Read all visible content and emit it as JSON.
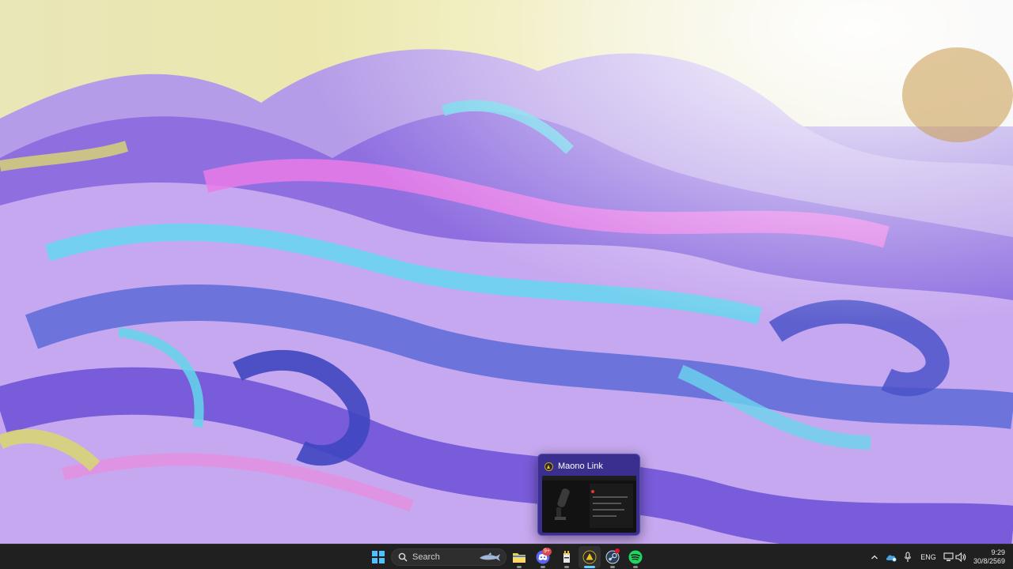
{
  "preview": {
    "title": "Maono Link",
    "app_icon": "maono-link-icon"
  },
  "taskbar": {
    "search_label": "Search",
    "discord_badge": "9+",
    "items": [
      "start-icon",
      "search-input",
      "file-explorer-icon",
      "discord-icon",
      "tool-icon",
      "maono-link-icon",
      "steam-icon",
      "spotify-icon"
    ]
  },
  "tray": {
    "language": "ENG",
    "time": "9:29",
    "date": "30/8/2569"
  },
  "colors": {
    "taskbar_bg": "#202020",
    "accent": "#60cdff",
    "preview_bg": "#3a2f8f"
  }
}
